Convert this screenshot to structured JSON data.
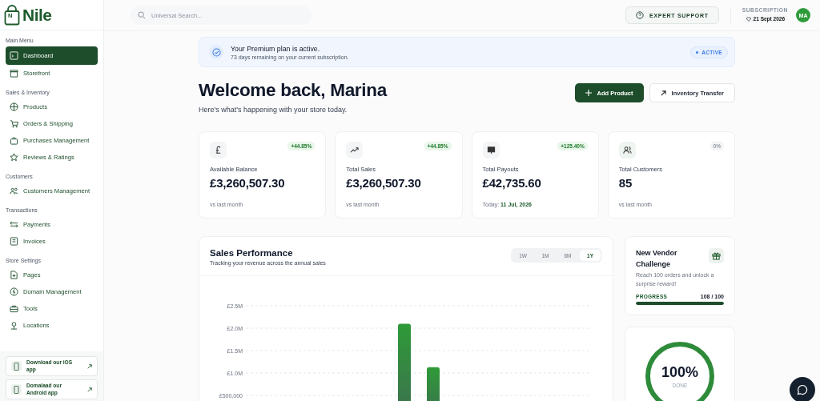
{
  "logo": {
    "text": "Nile",
    "mark": "N"
  },
  "sidebar": {
    "sections": [
      {
        "title": "Main Menu",
        "items": [
          {
            "label": "Dashboard",
            "selected": true
          },
          {
            "label": "Storefront",
            "selected": false
          }
        ]
      },
      {
        "title": "Sales & Inventory",
        "items": [
          {
            "label": "Products",
            "selected": false
          },
          {
            "label": "Orders & Shipping",
            "selected": false
          },
          {
            "label": "Purchases Management",
            "selected": false
          },
          {
            "label": "Reviews & Ratings",
            "selected": false
          }
        ]
      },
      {
        "title": "Customers",
        "items": [
          {
            "label": "Customers Management",
            "selected": false
          }
        ]
      },
      {
        "title": "Transactions",
        "items": [
          {
            "label": "Payments",
            "selected": false
          },
          {
            "label": "Invoices",
            "selected": false
          }
        ]
      },
      {
        "title": "Store Settings",
        "items": [
          {
            "label": "Pages",
            "selected": false
          },
          {
            "label": "Domain Management",
            "selected": false
          },
          {
            "label": "Tools",
            "selected": false
          },
          {
            "label": "Locations",
            "selected": false
          }
        ]
      }
    ],
    "app_links": [
      "Download our iOS app",
      "Domalaad our Android app"
    ]
  },
  "header": {
    "search": {
      "placeholder": "Universal Search..."
    },
    "support_button": "EXPERT SUPPORT",
    "subscription": {
      "label": "SUBSCRIPTION",
      "date": "21 Sept 2026"
    },
    "avatar": "MA"
  },
  "plan_banner": {
    "title": "Your Premium plan is active.",
    "subtitle": "73 days remaining on your current subscription.",
    "status": "ACTIVE"
  },
  "welcome": {
    "title": "Welcome back, Marina",
    "subtitle": "Here's what's happening with your store today.",
    "buttons": [
      {
        "label": "Add Product",
        "kind": "primary"
      },
      {
        "label": "Inventory Transfer",
        "kind": "secondary"
      }
    ]
  },
  "stats": [
    {
      "label": "Available Balance",
      "value": "£3,260,507.30",
      "change": "+44.85%",
      "kind": "up",
      "footer": "vs last month"
    },
    {
      "label": "Total Sales",
      "value": "£3,260,507.30",
      "change": "+44.85%",
      "kind": "up",
      "footer": "vs last month"
    },
    {
      "label": "Total Payouts",
      "value": "£42,735.60",
      "change": "+125.40%",
      "kind": "up",
      "footer": "Today: **11 Jul, 2026**"
    },
    {
      "label": "Total Customers",
      "value": "85",
      "change": "0%",
      "kind": "flat",
      "footer": "vs last month"
    }
  ],
  "sales_performance": {
    "title": "Sales Performance",
    "subtitle": "Tracking your revenue across the annual sales",
    "ranges": [
      {
        "label": "1W",
        "selected": false
      },
      {
        "label": "1M",
        "selected": false
      },
      {
        "label": "6M",
        "selected": false
      },
      {
        "label": "1Y",
        "selected": true
      }
    ],
    "chart_data": {
      "type": "bar",
      "grid": true,
      "ylim": [
        0,
        2500000
      ],
      "values": [
        null,
        null,
        null,
        null,
        null,
        2100000,
        1130000,
        null,
        null,
        null,
        null,
        null
      ],
      "yticks": [
        {
          "value": 500000,
          "label": "£500,000"
        },
        {
          "value": 1000000,
          "label": "£1.0M"
        },
        {
          "value": 1500000,
          "label": "£1.5M"
        },
        {
          "value": 2000000,
          "label": "£2.0M"
        },
        {
          "value": 2500000,
          "label": "£2.5M"
        }
      ]
    }
  },
  "challenge": {
    "title": "New Vendor Challenge",
    "text": "Reach 100 orders and unlock a surprise reward!",
    "progress_label": "PROGRESS",
    "progress_value": "108 / 100",
    "level": 1
  },
  "completion": {
    "value": "100%",
    "label": "DONE"
  }
}
